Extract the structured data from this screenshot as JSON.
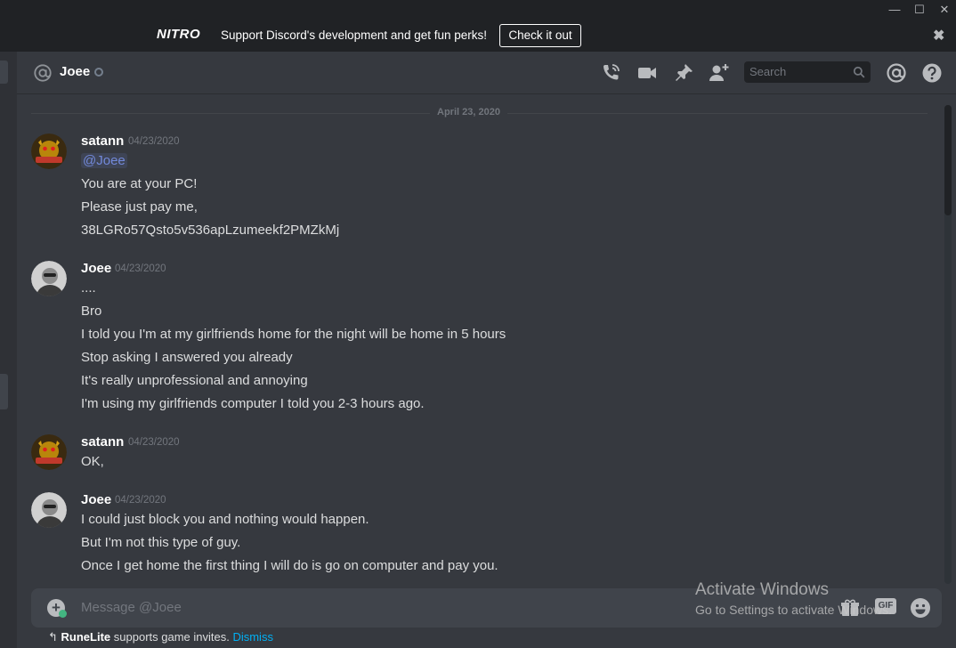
{
  "window": {
    "minimize_glyph": "—",
    "maximize_glyph": "☐",
    "close_glyph": "✕"
  },
  "banner": {
    "logo": "NITRO",
    "text": "Support Discord's development and get fun perks!",
    "cta": "Check it out",
    "close_glyph": "✖"
  },
  "header": {
    "channel_name": "Joee",
    "search_placeholder": "Search",
    "icons": [
      "at-icon",
      "phone-icon",
      "video-icon",
      "pin-icon",
      "add-friend-icon",
      "search-icon",
      "mentions-icon",
      "help-icon"
    ]
  },
  "date_divider": "April 23, 2020",
  "messages": [
    {
      "author": "satann",
      "timestamp": "04/23/2020",
      "lines": [
        "@Joee",
        "You are at your PC!",
        "Please just pay me,",
        "38LGRo57Qsto5v536apLzumeekf2PMZkMj"
      ]
    },
    {
      "author": "Joee",
      "timestamp": "04/23/2020",
      "lines": [
        "....",
        "Bro",
        "I told you I'm at my girlfriends home for the night will be home in 5 hours",
        "Stop asking I answered you already",
        "It's really unprofessional and annoying",
        "I'm using my girlfriends computer I told you 2-3 hours ago."
      ]
    },
    {
      "author": "satann",
      "timestamp": "04/23/2020",
      "lines": [
        "OK,"
      ]
    },
    {
      "author": "Joee",
      "timestamp": "04/23/2020",
      "lines": [
        "I could just block you and nothing would happen.",
        "But I'm not this type of guy.",
        "Once I get home the first thing I will do is go on computer and pay you."
      ]
    }
  ],
  "composer": {
    "placeholder": "Message @Joee",
    "gif_label": "GIF"
  },
  "watermark": {
    "title": "Activate Windows",
    "subtitle": "Go to Settings to activate Windows."
  },
  "notice": {
    "brand": "RuneLite",
    "text": " supports game invites. ",
    "dismiss": "Dismiss"
  },
  "colors": {
    "background": "#36393f",
    "mention": "#7289da",
    "link": "#00b0f4",
    "satann_avatar": "#b8860b"
  }
}
